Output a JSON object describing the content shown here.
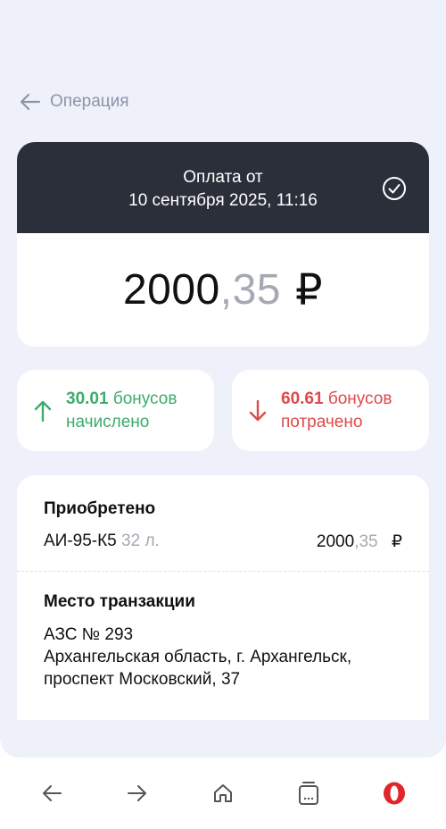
{
  "header": {
    "back_label": "Операция"
  },
  "payment": {
    "title_line1": "Оплата от",
    "title_line2": "10 сентября 2025, 11:16",
    "amount_int": "2000",
    "amount_frac": ",35",
    "currency": "₽"
  },
  "bonuses": {
    "accrued_value": "30.01",
    "accrued_word": "бонусов",
    "accrued_label": "начислено",
    "spent_value": "60.61",
    "spent_word": "бонусов",
    "spent_label": "потрачено"
  },
  "purchase": {
    "title": "Приобретено",
    "product": "АИ-95-К5",
    "quantity": "32 л.",
    "amount_int": "2000",
    "amount_frac": ",35",
    "currency": "₽"
  },
  "location": {
    "title": "Место транзакции",
    "station": "АЗС № 293",
    "line2": "Архангельская область, г. Архангельск,",
    "line3": "проспект Московский, 37"
  },
  "colors": {
    "accrued": "#3dab6a",
    "spent": "#de4a4a",
    "header_bg": "#2b2f3a",
    "page_bg": "#eef1f9",
    "brand": "#e0252c"
  },
  "navbar": {
    "icons": [
      "arrow-left-icon",
      "arrow-right-icon",
      "home-icon",
      "tabs-icon",
      "opera-icon"
    ]
  }
}
